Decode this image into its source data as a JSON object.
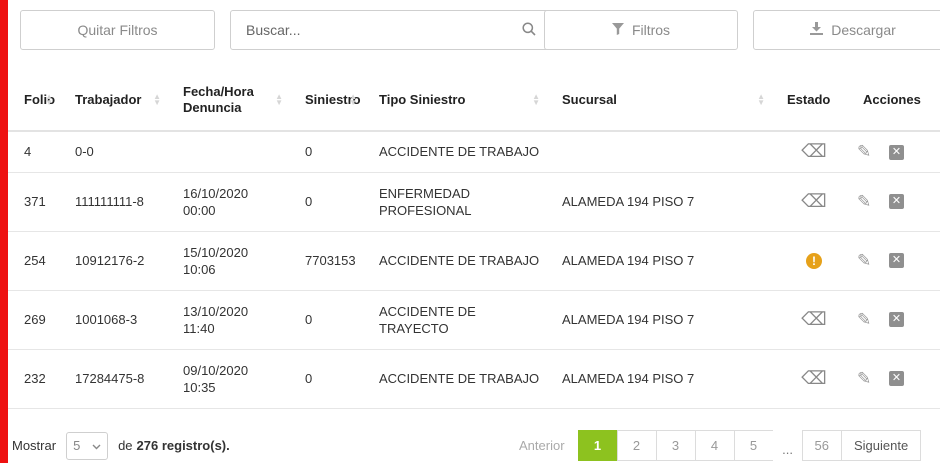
{
  "toolbar": {
    "clear_filters_label": "Quitar Filtros",
    "search_placeholder": "Buscar...",
    "filters_label": "Filtros",
    "download_label": "Descargar"
  },
  "table": {
    "headers": [
      "Folio",
      "Trabajador",
      "Fecha/Hora Denuncia",
      "Siniestro",
      "Tipo Siniestro",
      "Sucursal",
      "Estado",
      "Acciones"
    ],
    "rows": [
      {
        "folio": "4",
        "trabajador": "0-0",
        "fecha": "",
        "hora": "",
        "siniestro": "0",
        "tipo": "ACCIDENTE DE TRABAJO",
        "sucursal": "",
        "estado": "eraser-icon"
      },
      {
        "folio": "371",
        "trabajador": "111111111-8",
        "fecha": "16/10/2020",
        "hora": "00:00",
        "siniestro": "0",
        "tipo": "ENFERMEDAD PROFESIONAL",
        "sucursal": "ALAMEDA 194 PISO 7",
        "estado": "eraser-icon"
      },
      {
        "folio": "254",
        "trabajador": "10912176-2",
        "fecha": "15/10/2020",
        "hora": "10:06",
        "siniestro": "7703153",
        "tipo": "ACCIDENTE DE TRABAJO",
        "sucursal": "ALAMEDA 194 PISO 7",
        "estado": "warning-icon"
      },
      {
        "folio": "269",
        "trabajador": "1001068-3",
        "fecha": "13/10/2020",
        "hora": "11:40",
        "siniestro": "0",
        "tipo": "ACCIDENTE DE TRAYECTO",
        "sucursal": "ALAMEDA 194 PISO 7",
        "estado": "eraser-icon"
      },
      {
        "folio": "232",
        "trabajador": "17284475-8",
        "fecha": "09/10/2020",
        "hora": "10:35",
        "siniestro": "0",
        "tipo": "ACCIDENTE DE TRABAJO",
        "sucursal": "ALAMEDA 194 PISO 7",
        "estado": "eraser-icon"
      }
    ]
  },
  "footer": {
    "show_label": "Mostrar",
    "page_size": "5",
    "of_label": "de",
    "total_records": "276 registro(s).",
    "pagination": {
      "prev": "Anterior",
      "pages": [
        "1",
        "2",
        "3",
        "4",
        "5"
      ],
      "ellipsis": "...",
      "last": "56",
      "next": "Siguiente",
      "active_page": "1"
    }
  },
  "colors": {
    "accent": "#8dc21f",
    "warning": "#e6a11a",
    "side_bar": "#ee1111"
  }
}
